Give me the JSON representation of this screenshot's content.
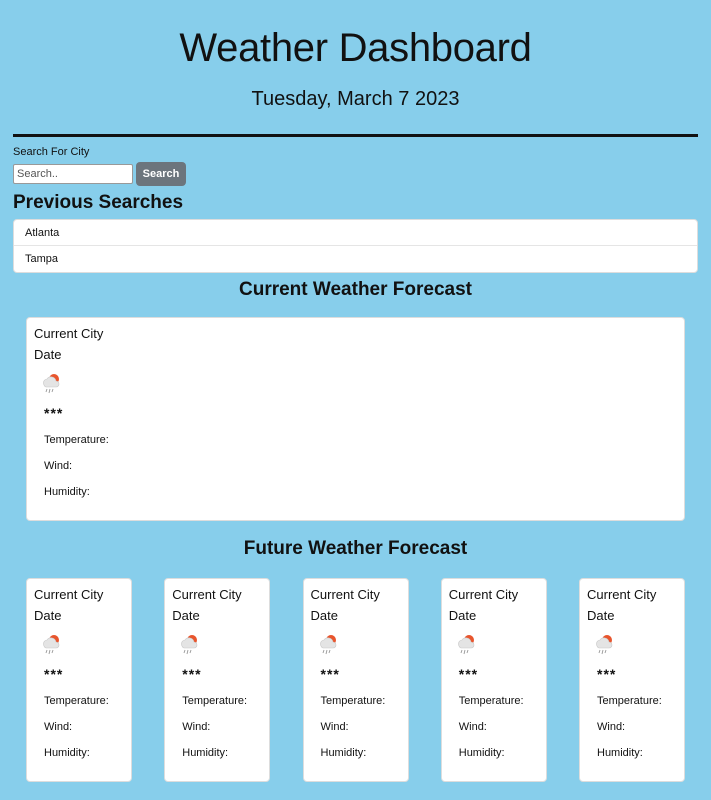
{
  "header": {
    "title": "Weather Dashboard",
    "date": "Tuesday, March 7 2023"
  },
  "search": {
    "label": "Search For City",
    "placeholder": "Search..",
    "button_label": "Search"
  },
  "previous": {
    "title": "Previous Searches",
    "items": [
      "Atlanta",
      "Tampa"
    ]
  },
  "current": {
    "title": "Current Weather Forecast",
    "card": {
      "city": "Current City",
      "date": "Date",
      "icon": "rain-sun-icon",
      "description": "***",
      "temperature": "Temperature:",
      "wind": "Wind:",
      "humidity": "Humidity:"
    }
  },
  "future": {
    "title": "Future Weather Forecast",
    "cards": [
      {
        "city": "Current City",
        "date": "Date",
        "icon": "rain-sun-icon",
        "description": "***",
        "temperature": "Temperature:",
        "wind": "Wind:",
        "humidity": "Humidity:"
      },
      {
        "city": "Current City",
        "date": "Date",
        "icon": "rain-sun-icon",
        "description": "***",
        "temperature": "Temperature:",
        "wind": "Wind:",
        "humidity": "Humidity:"
      },
      {
        "city": "Current City",
        "date": "Date",
        "icon": "rain-sun-icon",
        "description": "***",
        "temperature": "Temperature:",
        "wind": "Wind:",
        "humidity": "Humidity:"
      },
      {
        "city": "Current City",
        "date": "Date",
        "icon": "rain-sun-icon",
        "description": "***",
        "temperature": "Temperature:",
        "wind": "Wind:",
        "humidity": "Humidity:"
      },
      {
        "city": "Current City",
        "date": "Date",
        "icon": "rain-sun-icon",
        "description": "***",
        "temperature": "Temperature:",
        "wind": "Wind:",
        "humidity": "Humidity:"
      }
    ]
  },
  "colors": {
    "background": "#87ceeb",
    "button": "#6c757d",
    "sun": "#e8552d"
  }
}
